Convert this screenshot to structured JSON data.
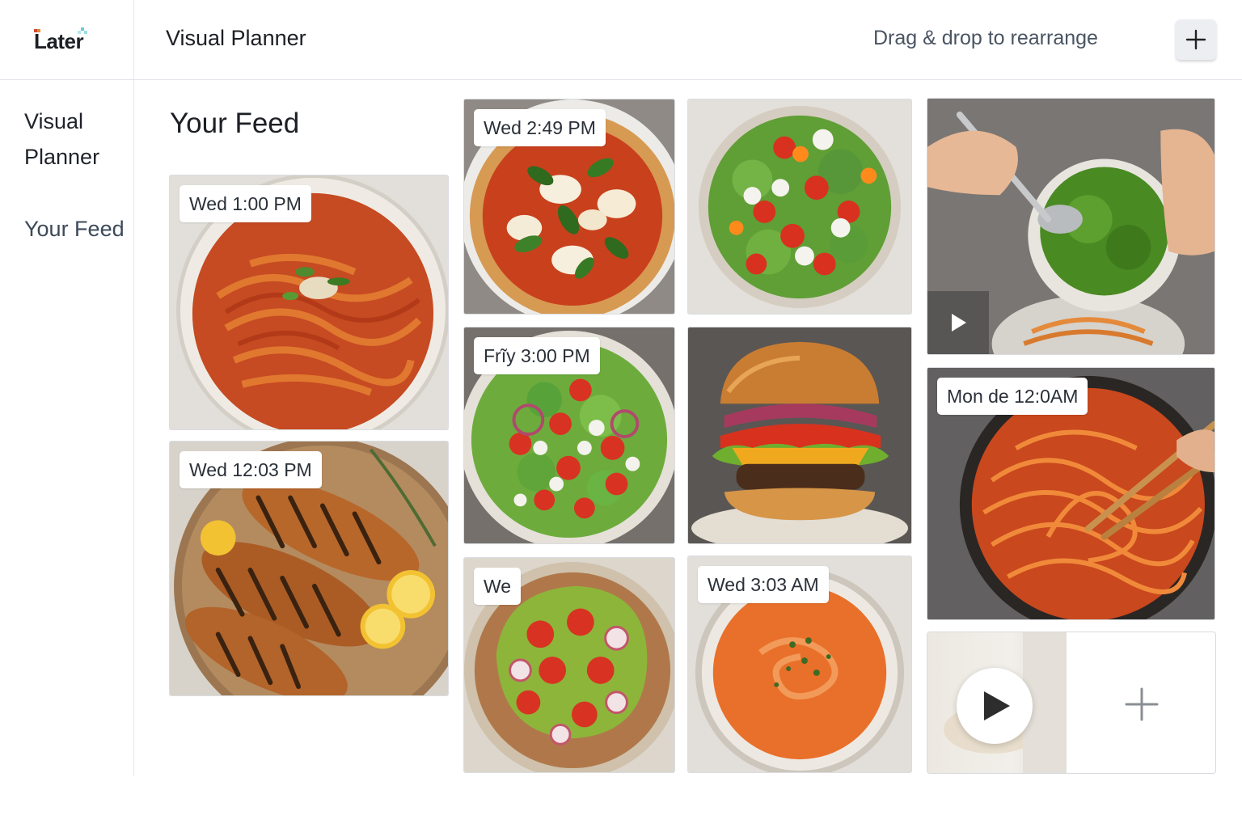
{
  "app": {
    "logo_text": "Later",
    "title": "Visual Planner",
    "hint": "Drag & drop to rearrange",
    "add_icon": "plus-icon"
  },
  "sidebar": {
    "items": [
      {
        "label": "Visual Planner"
      },
      {
        "label": "Your Feed"
      }
    ]
  },
  "feed": {
    "title": "Your Feed",
    "posts": [
      {
        "badge": "Wed 1:00 PM",
        "subject": "spaghetti bowl"
      },
      {
        "badge": "Wed 12:03 PM",
        "subject": "grilled chicken"
      },
      {
        "badge": "Wed 2:49 PM",
        "subject": "margherita pizza"
      },
      {
        "badge": "Frĩy 3:00 PM",
        "subject": "caprese salad"
      },
      {
        "badge": "We",
        "subject": "avocado toast"
      },
      {
        "badge": "",
        "subject": "tomato mozzarella salad"
      },
      {
        "badge": "",
        "subject": "cheeseburger"
      },
      {
        "badge": "Wed 3:03 AM",
        "subject": "tomato soup"
      },
      {
        "badge": "",
        "subject": "pesto bowl",
        "media": "video"
      },
      {
        "badge": "Mon de 12:0AM",
        "subject": "pasta in pan"
      }
    ],
    "upload": {
      "play_icon": "play-icon",
      "add_icon": "plus-icon"
    }
  },
  "colors": {
    "accent_cyan": "#67c8e0",
    "accent_red": "#d04a2e",
    "border": "#dadde1"
  }
}
